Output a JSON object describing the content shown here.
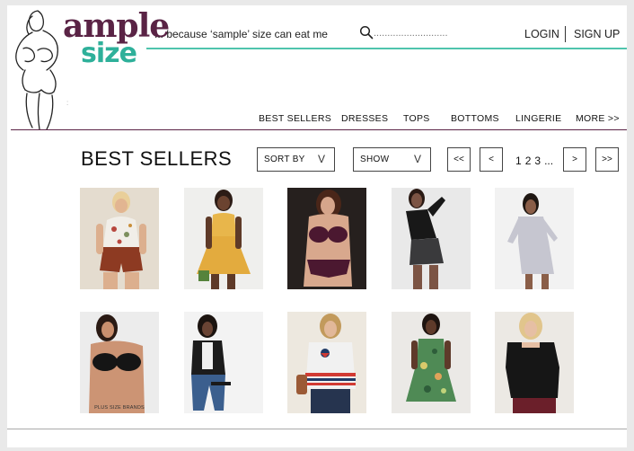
{
  "header": {
    "logo_word_1": "ample",
    "logo_word_2": "size",
    "tagline": "... because ‘sample’ size can eat me",
    "search_placeholder": "...........................",
    "login_label": "LOGIN",
    "signup_label": "SIGN UP",
    "colors": {
      "brand_purple": "#5a2345",
      "brand_teal": "#2eb09a",
      "accent_line": "#4fc4ad"
    }
  },
  "nav": {
    "items": [
      {
        "label": "BEST SELLERS"
      },
      {
        "label": "DRESSES"
      },
      {
        "label": "TOPS"
      },
      {
        "label": "BOTTOMS"
      },
      {
        "label": "LINGERIE"
      },
      {
        "label": "MORE >>"
      }
    ]
  },
  "listing": {
    "title": "BEST SELLERS",
    "sort_label": "SORT BY",
    "show_label": "SHOW",
    "dropdown_arrow": "V",
    "first_label": "<<",
    "prev_label": "<",
    "pages": [
      "1",
      "2",
      "3",
      "..."
    ],
    "next_label": ">",
    "last_label": ">>"
  },
  "products": [
    {
      "icon": "woman-floral-top-shorts-photo"
    },
    {
      "icon": "woman-yellow-dress-photo"
    },
    {
      "icon": "woman-burgundy-lingerie-photo"
    },
    {
      "icon": "woman-black-top-skirt-photo"
    },
    {
      "icon": "woman-grey-wrap-dress-photo"
    },
    {
      "icon": "woman-black-bra-photo",
      "caption": "PLUS SIZE BRANDS"
    },
    {
      "icon": "woman-black-jacket-jeans-photo"
    },
    {
      "icon": "woman-striped-sweater-photo"
    },
    {
      "icon": "woman-floral-dress-photo"
    },
    {
      "icon": "woman-black-top-photo"
    }
  ]
}
